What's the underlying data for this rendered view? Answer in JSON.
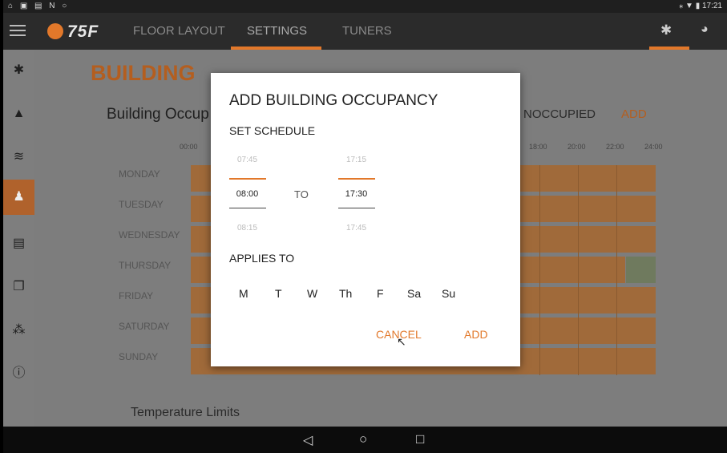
{
  "status_bar": {
    "left_icons": "⌂ ▣ ▤ N ○",
    "right": "⁎ ▼ ▮ 17:21"
  },
  "app_bar": {
    "logo": "75F",
    "tabs": [
      "FLOOR LAYOUT",
      "SETTINGS",
      "TUNERS"
    ],
    "active_tab": "SETTINGS",
    "accent_color": "#e2782a"
  },
  "sidebar": {
    "icons": [
      "gear-icon",
      "lock-icon",
      "wifi-icon",
      "user-settings-icon",
      "server-icon",
      "copy-icon",
      "network-icon",
      "help-icon"
    ],
    "selected": "user-settings-icon"
  },
  "main": {
    "heading": "BUILDING",
    "occupancy_title": "Building Occup",
    "unoccupied_label": "NOCCUPIED",
    "add_label": "ADD",
    "hours": [
      "00:00",
      "18:00",
      "20:00",
      "22:00",
      "24:00"
    ],
    "days": [
      "MONDAY",
      "TUESDAY",
      "WEDNESDAY",
      "THURSDAY",
      "FRIDAY",
      "SATURDAY",
      "SUNDAY"
    ],
    "temperature_limits": "Temperature Limits"
  },
  "dialog": {
    "title": "ADD BUILDING OCCUPANCY",
    "set_schedule": "SET SCHEDULE",
    "start": {
      "prev": "07:45",
      "current": "08:00",
      "next": "08:15"
    },
    "to_label": "TO",
    "end": {
      "prev": "17:15",
      "current": "17:30",
      "next": "17:45"
    },
    "applies_to": "APPLIES TO",
    "days": [
      "M",
      "T",
      "W",
      "Th",
      "F",
      "Sa",
      "Su"
    ],
    "cancel": "CANCEL",
    "add": "ADD"
  },
  "nav_bar": {
    "back": "◁",
    "home": "○",
    "recents": "□"
  }
}
